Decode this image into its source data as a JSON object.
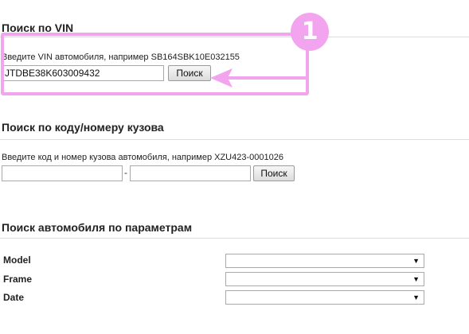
{
  "vin_search": {
    "title": "Поиск по VIN",
    "hint": "Введите VIN автомобиля, например SB164SBK10E032155",
    "input_value": "JTDBE38K603009432",
    "button_label": "Поиск"
  },
  "body_search": {
    "title": "Поиск по коду/номеру кузова",
    "hint": "Введите код и номер кузова автомобиля, например XZU423-0001026",
    "code_value": "",
    "number_value": "",
    "separator": "-",
    "button_label": "Поиск"
  },
  "param_search": {
    "title": "Поиск автомобиля по параметрам",
    "params": [
      {
        "label": "Model",
        "value": ""
      },
      {
        "label": "Frame",
        "value": ""
      },
      {
        "label": "Date",
        "value": ""
      }
    ]
  },
  "annotation": {
    "badge": "1",
    "color": "#f3a4ee"
  },
  "icons": {
    "dropdown": "chevron-down-icon",
    "annotation_arrow": "arrow-left-icon"
  }
}
